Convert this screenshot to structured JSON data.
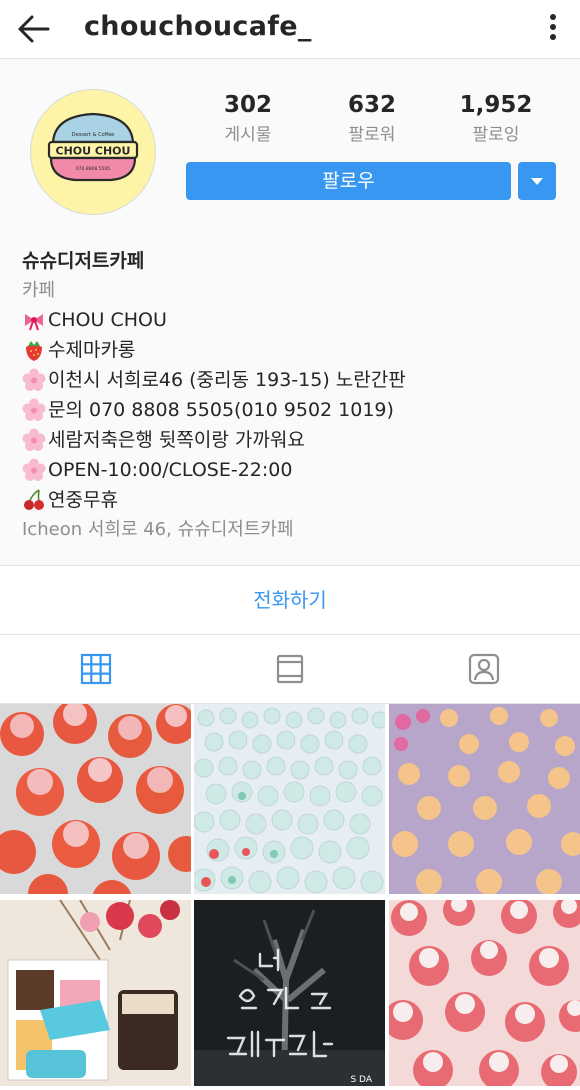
{
  "header": {
    "username": "chouchoucafe_",
    "back_icon": "arrow-left-icon",
    "menu_icon": "more-vertical-icon"
  },
  "profile": {
    "avatar": {
      "logo_text": "CHOU CHOU",
      "logo_top_text": "Dessert & Coffee",
      "logo_bottom_text": "070.8808.5505",
      "background_color": "#fdf4a8"
    },
    "stats": [
      {
        "value": "302",
        "label": "게시물"
      },
      {
        "value": "632",
        "label": "팔로워"
      },
      {
        "value": "1,952",
        "label": "팔로잉"
      }
    ],
    "follow_label": "팔로우",
    "dropdown_icon": "caret-down-icon",
    "accent_color": "#3897f0"
  },
  "bio": {
    "name": "슈슈디저트카페",
    "category": "카페",
    "lines": [
      {
        "icon": "ribbon-icon",
        "text": "CHOU CHOU"
      },
      {
        "icon": "strawberry-icon",
        "text": "수제마카롱"
      },
      {
        "icon": "cherry-blossom-icon",
        "text": "이천시 서희로46 (중리동 193-15) 노란간판"
      },
      {
        "icon": "cherry-blossom-icon",
        "text": "문의 070 8808 5505(010 9502 1019)"
      },
      {
        "icon": "cherry-blossom-icon",
        "text": "세람저축은행 뒷쪽이랑 가까워요"
      },
      {
        "icon": "cherry-blossom-icon",
        "text": "OPEN-10:00/CLOSE-22:00"
      },
      {
        "icon": "cherries-icon",
        "text": "연중무휴"
      }
    ],
    "location": "Icheon 서희로 46, 슈슈디저트카페"
  },
  "call_button_label": "전화하기",
  "tabs": [
    {
      "icon": "grid-icon",
      "active": true
    },
    {
      "icon": "feed-icon",
      "active": false
    },
    {
      "icon": "tagged-icon",
      "active": false
    }
  ],
  "posts": [
    {
      "subject": "meringue-macarons",
      "overlay_text": ""
    },
    {
      "subject": "mint-meringue-drops",
      "overlay_text": ""
    },
    {
      "subject": "flower-meringues",
      "overlay_text": ""
    },
    {
      "subject": "dessert-box-flowers",
      "overlay_text": ""
    },
    {
      "subject": "night-tree-handwriting",
      "overlay_text": "넌 오늘도 예쁘구나",
      "watermark": "S DA"
    },
    {
      "subject": "pink-meringues",
      "overlay_text": ""
    }
  ]
}
